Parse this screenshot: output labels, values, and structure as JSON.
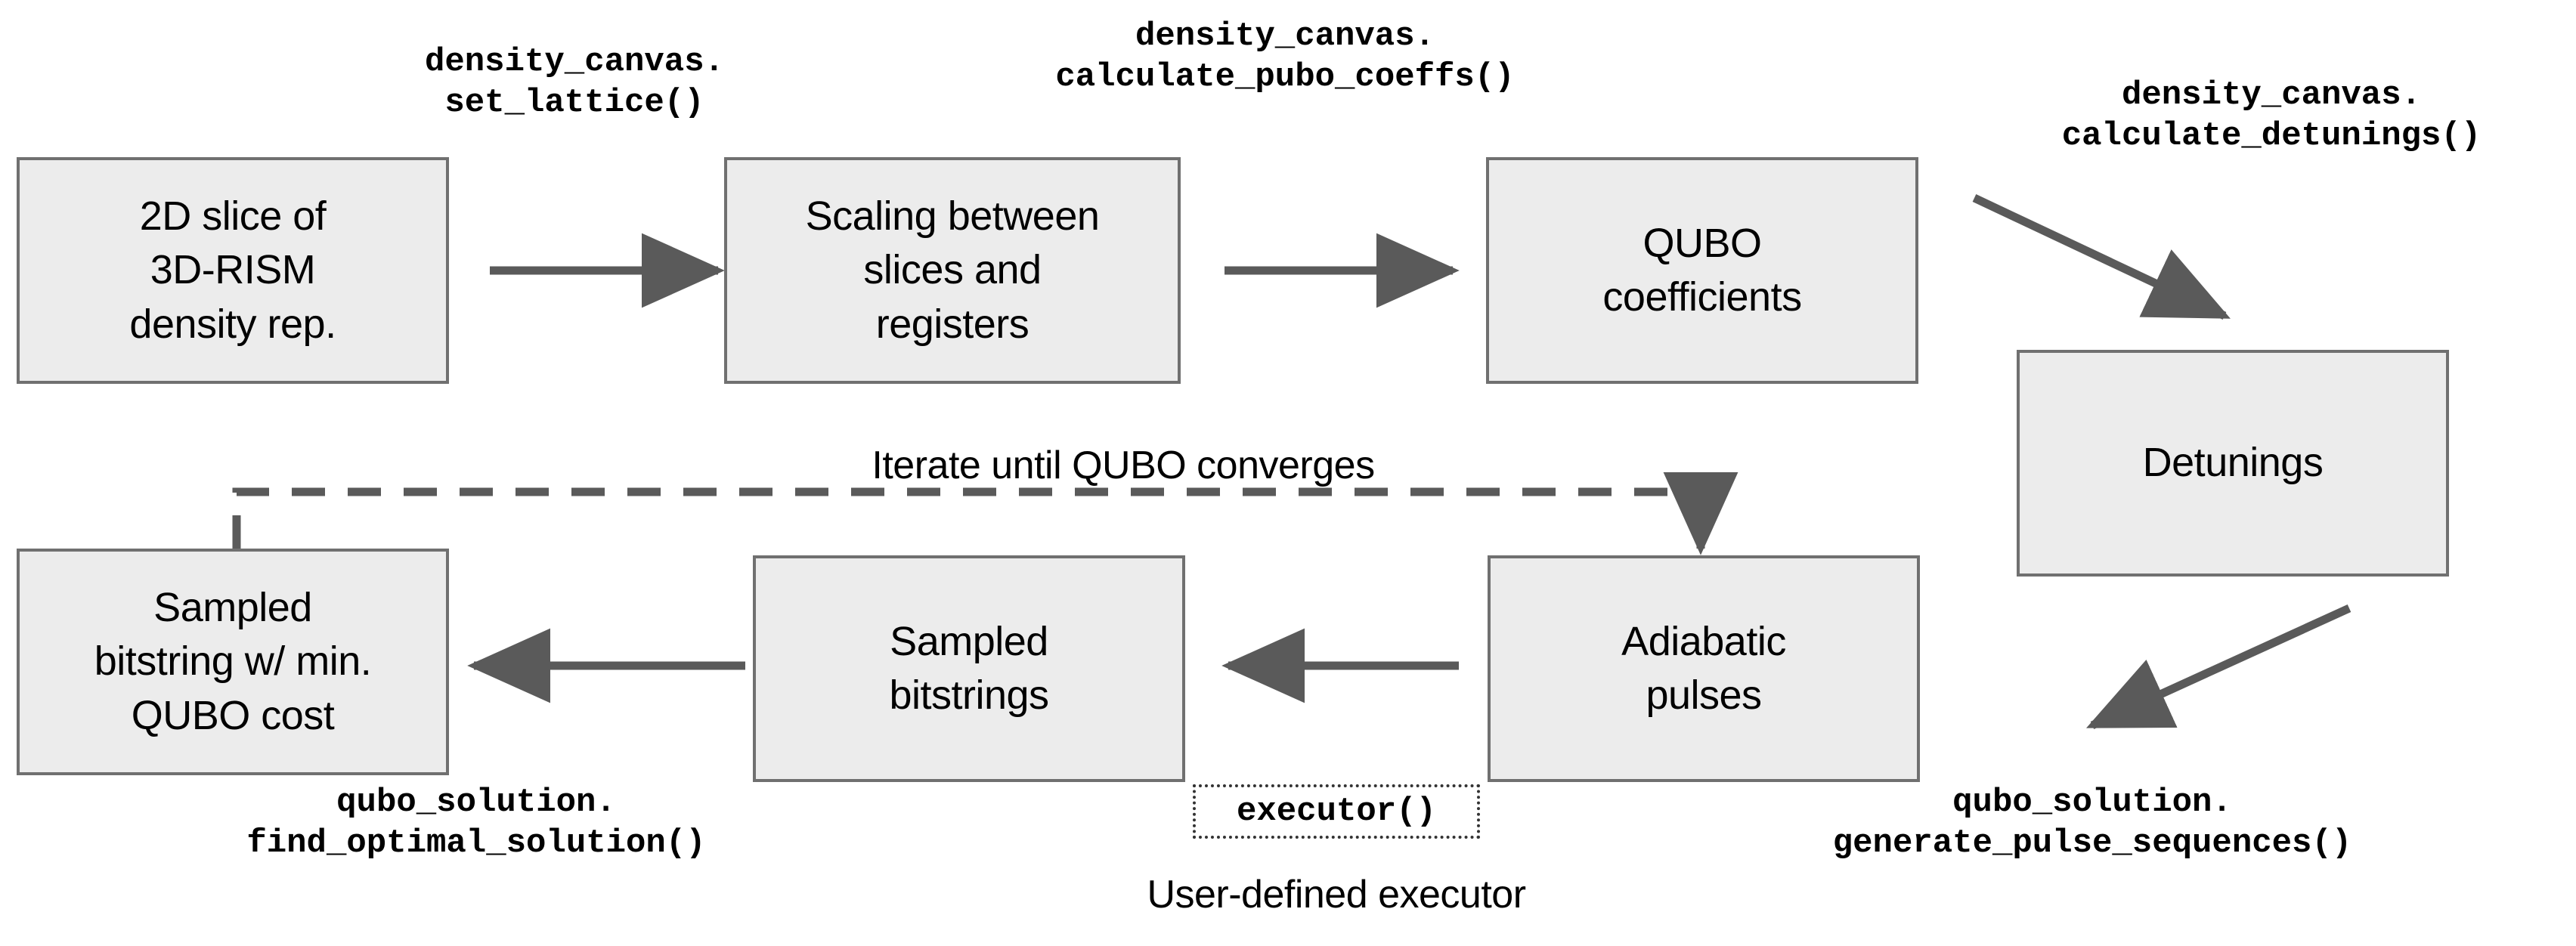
{
  "diagram": {
    "type": "flowchart",
    "title_visible": false,
    "colors": {
      "box_fill": "#ececec",
      "box_border": "#707070",
      "arrow": "#5a5a5a",
      "text": "#000000",
      "background": "#ffffff",
      "dotted_border": "#333333"
    },
    "nodes": [
      {
        "id": "slice",
        "label": "2D slice of\n3D-RISM\ndensity rep."
      },
      {
        "id": "scaling",
        "label": "Scaling between\nslices and\nregisters"
      },
      {
        "id": "qubo",
        "label": "QUBO\ncoefficients"
      },
      {
        "id": "detunings",
        "label": "Detunings"
      },
      {
        "id": "pulses",
        "label": "Adiabatic\npulses"
      },
      {
        "id": "bitstrings",
        "label": "Sampled\nbitstrings"
      },
      {
        "id": "min_bitstring",
        "label": "Sampled\nbitstring w/ min.\nQUBO cost"
      }
    ],
    "code_labels": [
      {
        "id": "set_lattice",
        "text": "density_canvas.\nset_lattice()"
      },
      {
        "id": "calculate_pubo_coeffs",
        "text": "density_canvas.\ncalculate_pubo_coeffs()"
      },
      {
        "id": "calculate_detunings",
        "text": "density_canvas.\ncalculate_detunings()"
      },
      {
        "id": "generate_pulse_sequences",
        "text": "qubo_solution.\ngenerate_pulse_sequences()"
      },
      {
        "id": "find_optimal_solution",
        "text": "qubo_solution.\nfind_optimal_solution()"
      },
      {
        "id": "executor",
        "text": "executor()"
      }
    ],
    "annotations": [
      {
        "id": "iterate",
        "text": "Iterate until QUBO converges"
      },
      {
        "id": "user_executor",
        "text": "User-defined executor"
      }
    ],
    "edges": [
      {
        "from": "slice",
        "to": "scaling",
        "style": "solid",
        "label_ref": "set_lattice"
      },
      {
        "from": "scaling",
        "to": "qubo",
        "style": "solid",
        "label_ref": "calculate_pubo_coeffs"
      },
      {
        "from": "qubo",
        "to": "detunings",
        "style": "solid",
        "label_ref": "calculate_detunings"
      },
      {
        "from": "detunings",
        "to": "pulses",
        "style": "solid",
        "label_ref": "generate_pulse_sequences"
      },
      {
        "from": "pulses",
        "to": "bitstrings",
        "style": "solid",
        "label_ref": "executor"
      },
      {
        "from": "bitstrings",
        "to": "min_bitstring",
        "style": "solid",
        "label_ref": "find_optimal_solution"
      },
      {
        "from": "min_bitstring",
        "to": "pulses",
        "style": "dashed",
        "label_ref": "iterate"
      }
    ]
  }
}
